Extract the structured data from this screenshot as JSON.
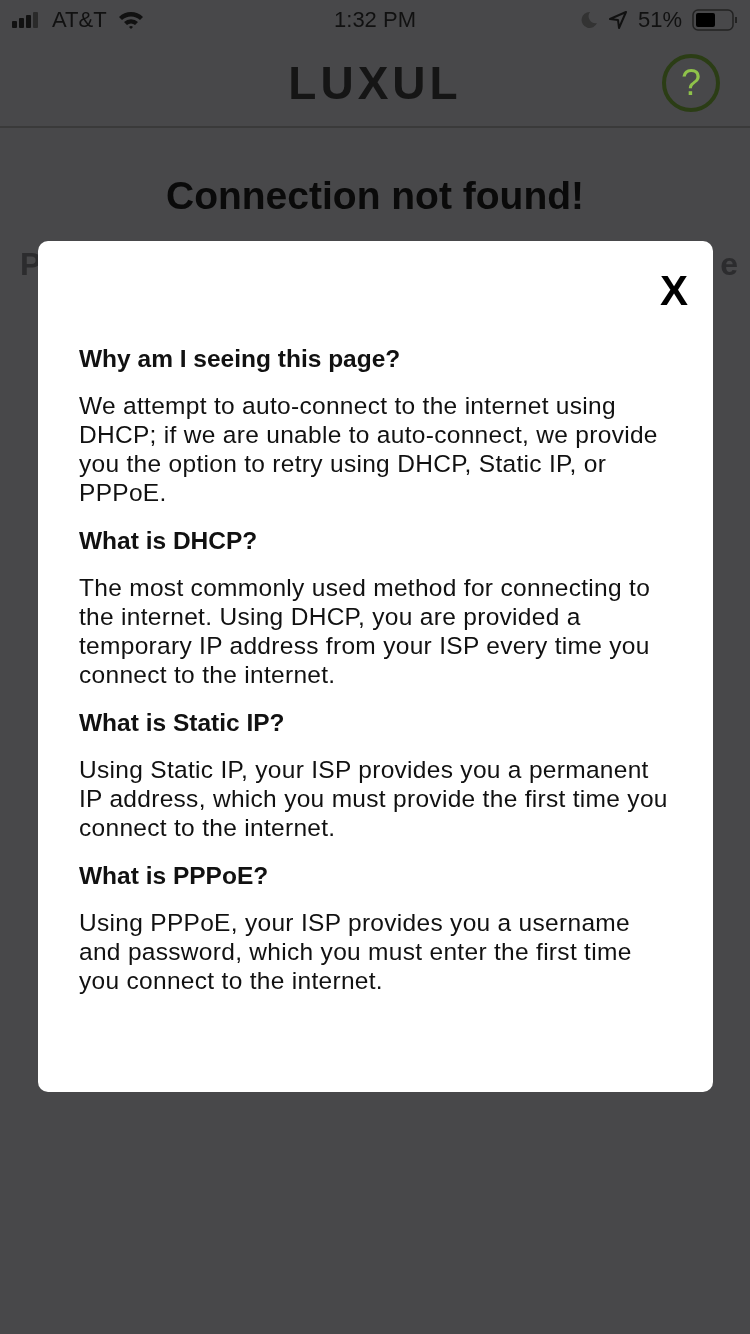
{
  "status_bar": {
    "carrier": "AT&T",
    "time": "1:32 PM",
    "battery": "51%"
  },
  "header": {
    "logo": "LUXUL",
    "help": "?"
  },
  "page": {
    "title": "Connection not found!",
    "hidden_line_start": "P",
    "hidden_line_end": "e"
  },
  "modal": {
    "close": "X",
    "sections": [
      {
        "heading": "Why am I seeing this page?",
        "body": "We attempt to auto-connect to the internet using DHCP; if we are unable to auto-connect, we provide you the option to retry using DHCP, Static IP, or PPPoE."
      },
      {
        "heading": "What is DHCP?",
        "body": "The most commonly used method for connecting to the internet. Using DHCP, you are provided a temporary IP address from your ISP every time you connect to the internet."
      },
      {
        "heading": "What is Static IP?",
        "body": "Using Static IP, your ISP provides you a permanent IP address, which you must provide the first time you connect to the internet."
      },
      {
        "heading": "What is PPPoE?",
        "body": "Using PPPoE, your ISP provides you a username and password, which you must enter the first time you connect to the internet."
      }
    ]
  }
}
